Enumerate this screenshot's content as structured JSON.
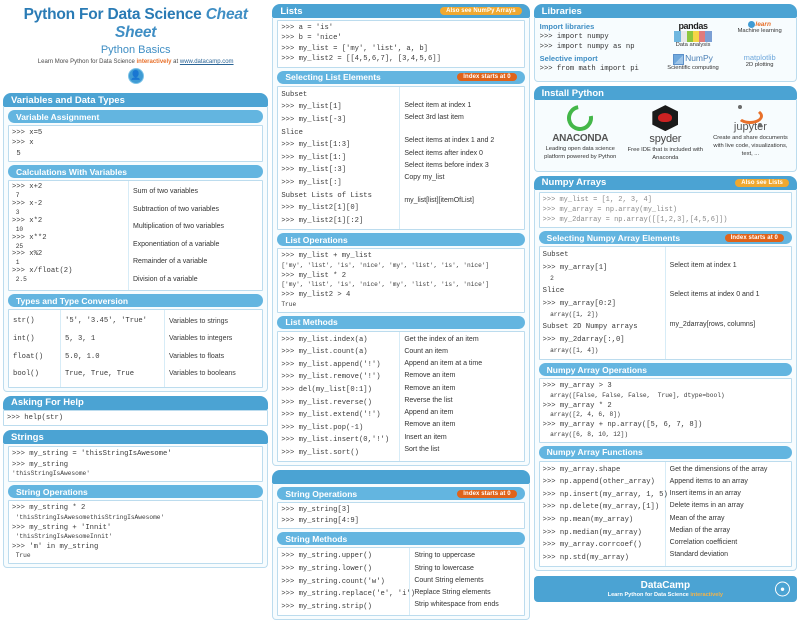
{
  "header": {
    "title_bold": "Python For Data Science",
    "title_italic": "Cheat Sheet",
    "subtitle": "Python Basics",
    "learn_pre": "Learn More Python for Data Science ",
    "learn_interactively": "interactively",
    "learn_at": " at ",
    "learn_link": "www.datacamp.com",
    "logo_icon": "datacamp-logo-icon"
  },
  "colors": {
    "section_blue": "#4ba3d3",
    "subsection_blue": "#63b5e0",
    "badge_orange": "#e0631a",
    "badge_yellow": "#f0a830",
    "string_pink": "#e08aa8",
    "border_blue": "#bcdcee"
  },
  "left": {
    "variables_section": "Variables and Data Types",
    "variable_assignment": {
      "title": "Variable Assignment",
      "lines": [
        ">>> x=5",
        ">>> x",
        " 5"
      ]
    },
    "calculations": {
      "title": "Calculations With Variables",
      "rows": [
        {
          "code": ">>> x+2",
          "out": " 7",
          "desc": "Sum of two variables"
        },
        {
          "code": ">>> x-2",
          "out": " 3",
          "desc": "Subtraction of two variables"
        },
        {
          "code": ">>> x*2",
          "out": " 10",
          "desc": "Multiplication of two variables"
        },
        {
          "code": ">>> x**2",
          "out": " 25",
          "desc": "Exponentiation of a variable"
        },
        {
          "code": ">>> x%2",
          "out": " 1",
          "desc": "Remainder of a variable"
        },
        {
          "code": ">>> x/float(2)",
          "out": " 2.5",
          "desc": "Division of a variable"
        }
      ]
    },
    "types": {
      "title": "Types and Type Conversion",
      "rows": [
        {
          "fn": "str()",
          "val": "'5', '3.45', 'True'",
          "val_style": "str",
          "desc": "Variables to strings"
        },
        {
          "fn": "int()",
          "val": "5, 3, 1",
          "val_style": "num",
          "desc": "Variables to integers"
        },
        {
          "fn": "float()",
          "val": "5.0, 1.0",
          "val_style": "num",
          "desc": "Variables to floats"
        },
        {
          "fn": "bool()",
          "val": "True, True, True",
          "val_style": "bool",
          "desc": "Variables to booleans"
        }
      ]
    },
    "help": {
      "title": "Asking For Help",
      "lines": [
        ">>> help(str)"
      ]
    },
    "strings_section": "Strings",
    "strings_box": {
      "lines": [
        ">>> my_string = 'thisStringIsAwesome'",
        ">>> my_string"
      ],
      "out": "'thisStringIsAwesome'"
    },
    "string_ops": {
      "title": "String Operations",
      "rows": [
        {
          "code": ">>> my_string * 2",
          "out": " 'thisStringIsAwesomethisStringIsAwesome'"
        },
        {
          "code": ">>> my_string + 'Innit'",
          "out": " 'thisStringIsAwesomeInnit'"
        },
        {
          "code": ">>> 'm' in my_string",
          "out": " True"
        }
      ]
    }
  },
  "mid": {
    "lists_section": "Lists",
    "lists_badge": "Also see NumPy Arrays",
    "lists_box": [
      ">>> a = 'is'",
      ">>> b = 'nice'",
      ">>> my_list = ['my', 'list', a, b]",
      ">>> my_list2 = [[4,5,6,7], [3,4,5,6]]"
    ],
    "selecting": {
      "title": "Selecting List Elements",
      "badge": "Index starts at 0",
      "groups": [
        {
          "label": "Subset",
          "codes": [
            ">>> my_list[1]",
            ">>> my_list[-3]"
          ],
          "descs": [
            "Select item at index 1",
            "Select 3rd last item"
          ]
        },
        {
          "label": "Slice",
          "codes": [
            ">>> my_list[1:3]",
            ">>> my_list[1:]",
            ">>> my_list[:3]",
            ">>> my_list[:]"
          ],
          "descs": [
            "Select items at index 1 and 2",
            "Select items after index 0",
            "Select items before index 3",
            "Copy my_list"
          ]
        },
        {
          "label": "Subset Lists of Lists",
          "codes": [
            ">>> my_list2[1][0]",
            ">>> my_list2[1][:2]"
          ],
          "descs": [
            "my_list[list][itemOfList]"
          ]
        }
      ]
    },
    "list_ops": {
      "title": "List Operations",
      "rows": [
        {
          "code": ">>> my_list + my_list",
          "out": "['my', 'list', 'is', 'nice', 'my', 'list', 'is', 'nice']"
        },
        {
          "code": ">>> my_list * 2",
          "out": "['my', 'list', 'is', 'nice', 'my', 'list', 'is', 'nice']"
        },
        {
          "code": ">>> my_list2 > 4",
          "out": "True"
        }
      ]
    },
    "list_methods": {
      "title": "List Methods",
      "rows": [
        {
          "code": ">>> my_list.index(a)",
          "desc": "Get the index of an item"
        },
        {
          "code": ">>> my_list.count(a)",
          "desc": "Count an item"
        },
        {
          "code": ">>> my_list.append('!')",
          "desc": "Append an item at a time"
        },
        {
          "code": ">>> my_list.remove('!')",
          "desc": "Remove an item"
        },
        {
          "code": ">>> del(my_list[0:1])",
          "desc": "Remove an item"
        },
        {
          "code": ">>> my_list.reverse()",
          "desc": "Reverse the list"
        },
        {
          "code": ">>> my_list.extend('!')",
          "desc": "Append an item"
        },
        {
          "code": ">>> my_list.pop(-1)",
          "desc": "Remove an item"
        },
        {
          "code": ">>> my_list.insert(0,'!')",
          "desc": "Insert an item"
        },
        {
          "code": ">>> my_list.sort()",
          "desc": "Sort the list"
        }
      ]
    },
    "strings_bar": "",
    "string_ops2": {
      "title": "String Operations",
      "badge": "Index starts at 0",
      "lines": [
        ">>> my_string[3]",
        ">>> my_string[4:9]"
      ]
    },
    "string_methods": {
      "title": "String Methods",
      "rows": [
        {
          "code": ">>> my_string.upper()",
          "desc": "String to uppercase"
        },
        {
          "code": ">>> my_string.lower()",
          "desc": "String to lowercase"
        },
        {
          "code": ">>> my_string.count('w')",
          "desc": "Count String elements"
        },
        {
          "code": ">>> my_string.replace('e', 'i')",
          "desc": "Replace String elements"
        },
        {
          "code": ">>> my_string.strip()",
          "desc": "Strip whitespace from ends"
        }
      ]
    }
  },
  "right": {
    "libraries_section": "Libraries",
    "import_label": "Import libraries",
    "import_lines": [
      ">>> import numpy",
      ">>> import numpy as np"
    ],
    "selective_label": "Selective import",
    "selective_lines": [
      ">>> from math import pi"
    ],
    "logos": [
      {
        "name": "pandas-logo",
        "title": "pandas",
        "caption": "Data analysis"
      },
      {
        "name": "scikit-learn-logo",
        "title": "learn",
        "caption": "Machine learning"
      },
      {
        "name": "numpy-logo",
        "title": "NumPy",
        "caption": "Scientific computing"
      },
      {
        "name": "matplotlib-logo",
        "title": "matplotlib",
        "caption": "2D plotting"
      }
    ],
    "install_section": "Install Python",
    "installs": [
      {
        "name": "anaconda-logo",
        "title": "ANACONDA",
        "desc": "Leading open data science platform powered by Python"
      },
      {
        "name": "spyder-logo",
        "title": "spyder",
        "desc": "Free IDE that is included with Anaconda"
      },
      {
        "name": "jupyter-logo",
        "title": "jupyter",
        "desc": "Create and share documents with live code, visualizations, text, ..."
      }
    ],
    "numpy_section": "Numpy Arrays",
    "numpy_badge": "Also see Lists",
    "numpy_box": [
      ">>> my_list = [1, 2, 3, 4]",
      ">>> my_array = np.array(my_list)",
      ">>> my_2darray = np.array([[1,2,3],[4,5,6]])"
    ],
    "selecting_np": {
      "title": "Selecting Numpy Array Elements",
      "badge": "Index starts at 0",
      "groups": [
        {
          "label": "Subset",
          "code": ">>> my_array[1]",
          "out": "  2",
          "desc": "Select item at index 1"
        },
        {
          "label": "Slice",
          "code": ">>> my_array[0:2]",
          "out": "  array([1, 2])",
          "desc": "Select items at index 0 and 1"
        },
        {
          "label": "Subset 2D Numpy arrays",
          "code": ">>> my_2darray[:,0]",
          "out": "  array([1, 4])",
          "desc": "my_2darray[rows, columns]"
        }
      ]
    },
    "numpy_ops": {
      "title": "Numpy Array Operations",
      "rows": [
        {
          "code": ">>> my_array > 3",
          "out": "  array([False, False, False,  True], dtype=bool)"
        },
        {
          "code": ">>> my_array * 2",
          "out": "  array([2, 4, 6, 8])"
        },
        {
          "code": ">>> my_array + np.array([5, 6, 7, 8])",
          "out": "  array([6, 8, 10, 12])"
        }
      ]
    },
    "numpy_funcs": {
      "title": "Numpy Array Functions",
      "rows": [
        {
          "code": ">>> my_array.shape",
          "desc": "Get the dimensions of the array"
        },
        {
          "code": ">>> np.append(other_array)",
          "desc": "Append items to an array"
        },
        {
          "code": ">>> np.insert(my_array, 1, 5)",
          "desc": "Insert items in an array"
        },
        {
          "code": ">>> np.delete(my_array,[1])",
          "desc": "Delete items in an array"
        },
        {
          "code": ">>> np.mean(my_array)",
          "desc": "Mean of the array"
        },
        {
          "code": ">>> np.median(my_array)",
          "desc": "Median of the array"
        },
        {
          "code": ">>> my_array.corrcoef()",
          "desc": "Correlation coefficient"
        },
        {
          "code": ">>> np.std(my_array)",
          "desc": "Standard deviation"
        }
      ]
    }
  },
  "footer": {
    "brand": "DataCamp",
    "tagline_pre": "Learn Python for Data Science ",
    "tagline_orange": "interactively",
    "logo_icon": "datacamp-logo-icon"
  }
}
